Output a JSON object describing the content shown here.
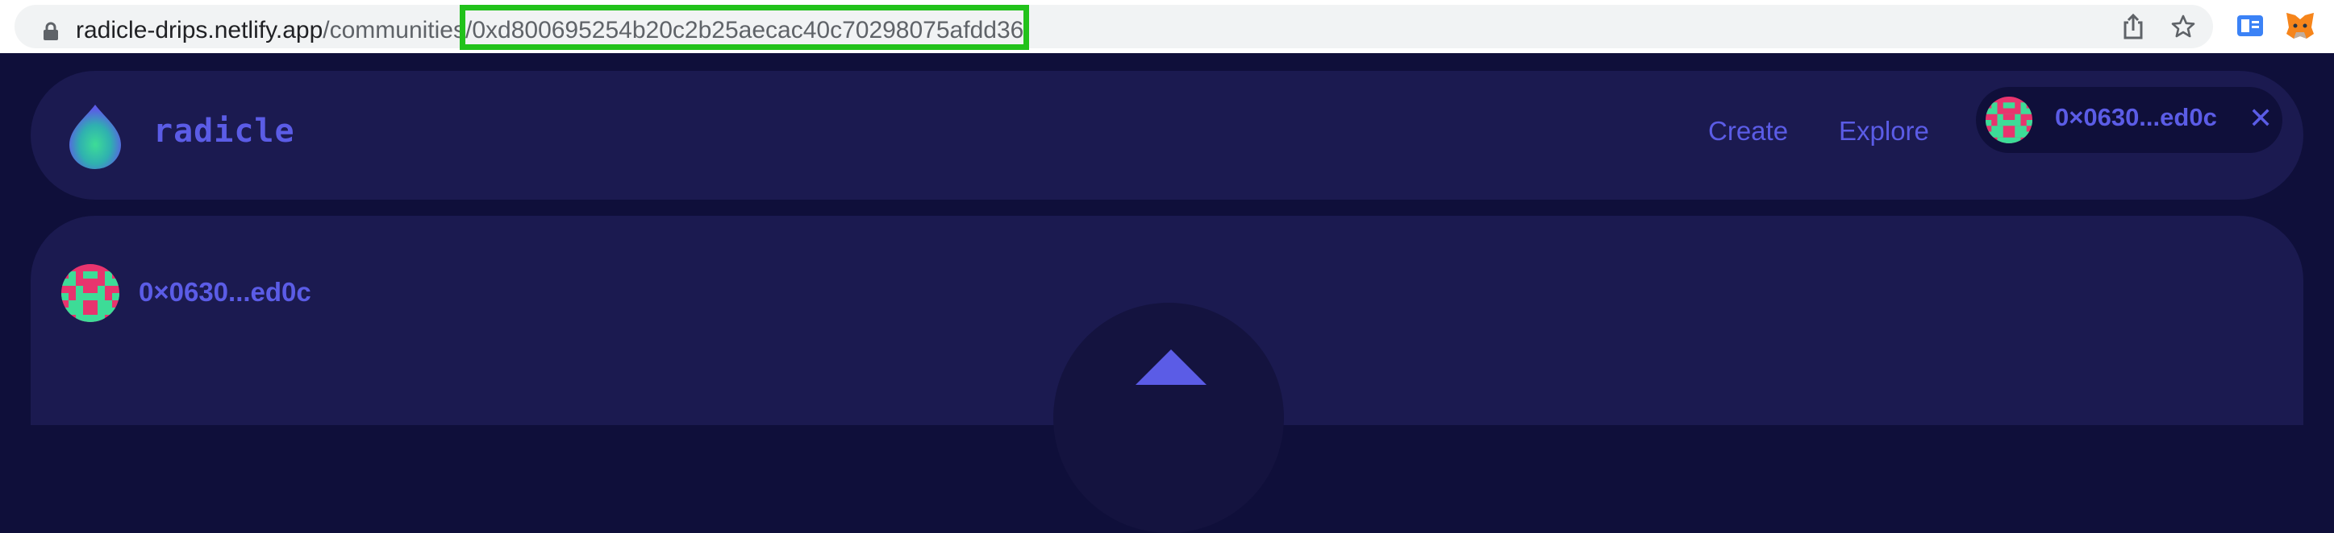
{
  "browser": {
    "url_host": "radicle-drips.netlify.app",
    "url_path": "/communities/",
    "url_id": "0xd800695254b20c2b25aecac40c70298075afdd36",
    "icons": [
      "lock-icon",
      "share-icon",
      "star-icon",
      "extension-icon",
      "metamask-fox-icon"
    ]
  },
  "header": {
    "logo_text": "radicle",
    "nav": {
      "create": "Create",
      "explore": "Explore"
    },
    "wallet": {
      "address": "0×0630...ed0c",
      "close": "✕"
    }
  },
  "main": {
    "owner_address": "0×0630...ed0c"
  },
  "colors": {
    "accent": "#5b5ce6",
    "background": "#0f0f3a",
    "card": "#1b1a50",
    "highlight": "#22c21b",
    "avatar_pink": "#e8346e",
    "avatar_green": "#3ddc97"
  }
}
